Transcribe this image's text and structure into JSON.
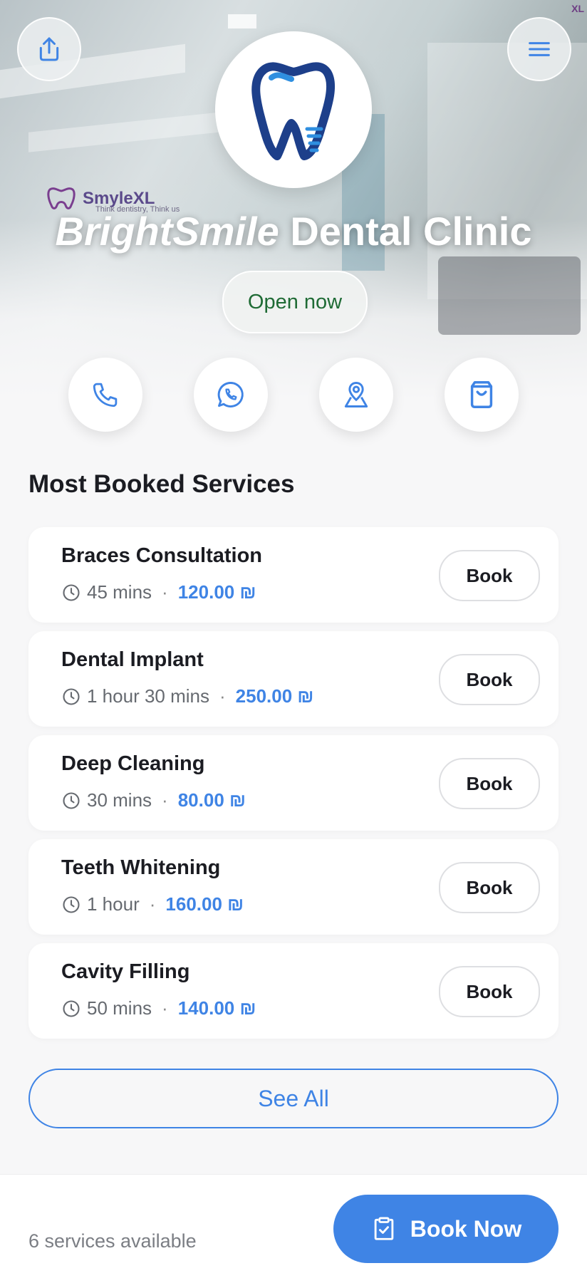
{
  "hero": {
    "background_watermark_brand": "SmyleXL",
    "background_watermark_tag": "Think dentistry, Think us",
    "corner_logo": "XL"
  },
  "clinic": {
    "name_italic": "BrightSmile",
    "name_rest": " Dental Clinic",
    "status": "Open now"
  },
  "actions": [
    {
      "name": "phone",
      "icon": "phone-icon"
    },
    {
      "name": "whatsapp",
      "icon": "whatsapp-icon"
    },
    {
      "name": "location",
      "icon": "map-pin-icon"
    },
    {
      "name": "shop",
      "icon": "shopping-bag-icon"
    }
  ],
  "section": {
    "title": "Most Booked Services"
  },
  "services": [
    {
      "name": "Braces Consultation",
      "duration": "45 mins",
      "price": "120.00 ₪",
      "book_label": "Book"
    },
    {
      "name": "Dental Implant",
      "duration": "1 hour 30 mins",
      "price": "250.00 ₪",
      "book_label": "Book"
    },
    {
      "name": "Deep Cleaning",
      "duration": "30 mins",
      "price": "80.00 ₪",
      "book_label": "Book"
    },
    {
      "name": "Teeth Whitening",
      "duration": "1 hour",
      "price": "160.00 ₪",
      "book_label": "Book"
    },
    {
      "name": "Cavity Filling",
      "duration": "50 mins",
      "price": "140.00 ₪",
      "book_label": "Book"
    }
  ],
  "see_all_label": "See All",
  "bottom": {
    "services_count": "6 services available",
    "book_now_label": "Book Now"
  },
  "colors": {
    "accent": "#3f84e5",
    "status_green": "#1f6b35",
    "logo_navy": "#1d3f8a",
    "logo_blue": "#2f8fe0"
  },
  "dot": "·"
}
